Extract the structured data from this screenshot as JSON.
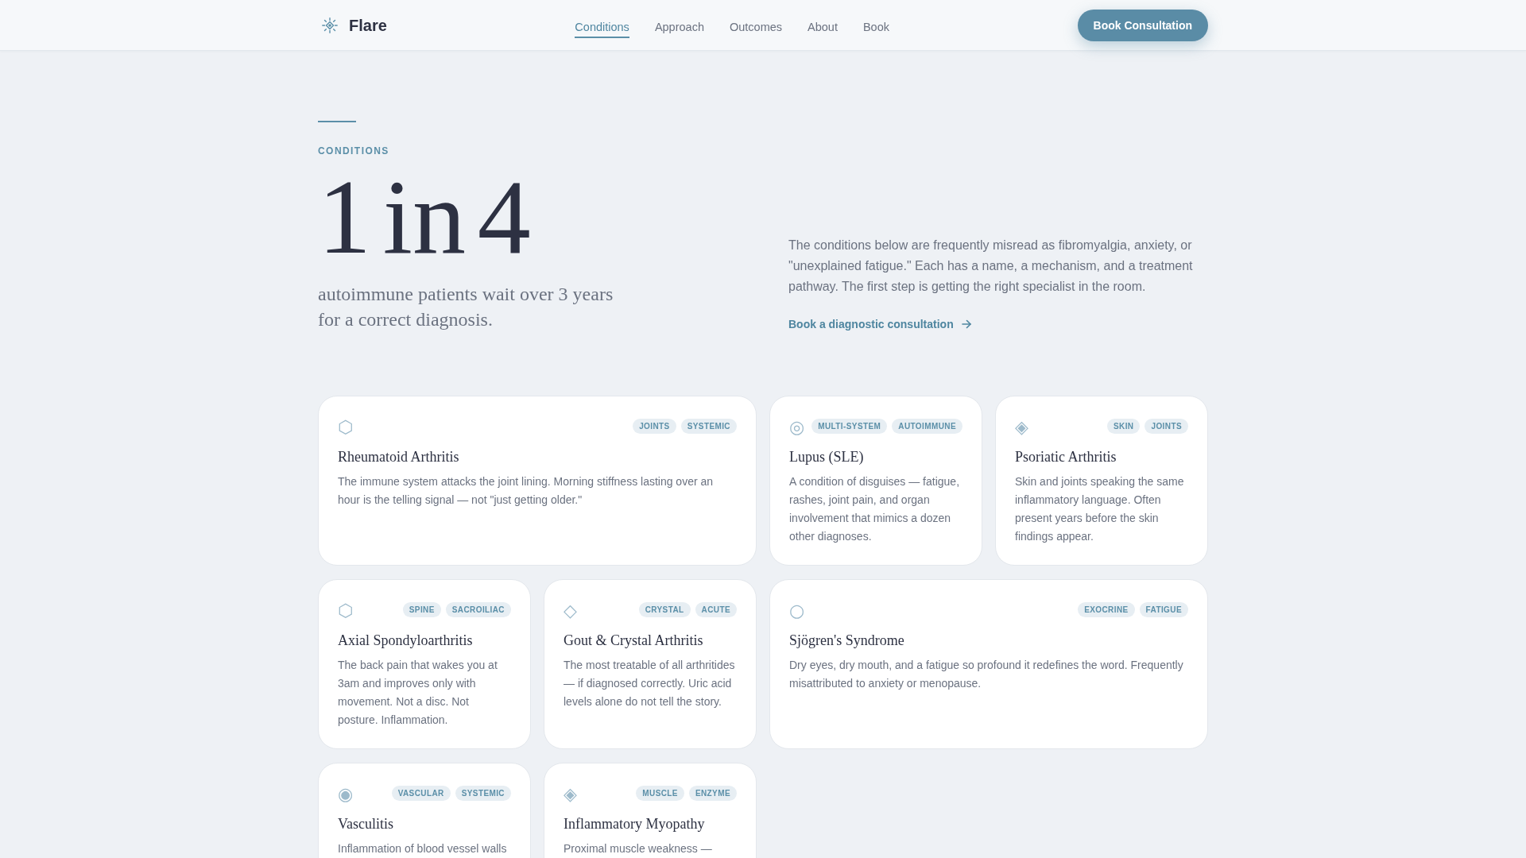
{
  "header": {
    "logo": "Flare",
    "nav": [
      {
        "label": "Conditions",
        "selected": true
      },
      {
        "label": "Approach",
        "selected": false
      },
      {
        "label": "Outcomes",
        "selected": false
      },
      {
        "label": "About",
        "selected": false
      },
      {
        "label": "Book",
        "selected": false
      }
    ],
    "cta": "Book Consultation"
  },
  "hero": {
    "eyebrow": "CONDITIONS",
    "headline": "1 in 4",
    "subheadline": "autoimmune patients wait over 3 years for a correct diagnosis.",
    "description": "The conditions below are frequently misread as fibromyalgia, anxiety, or \"unexplained fatigue.\" Each has a name, a mechanism, and a treatment pathway. The first step is getting the right specialist in the room.",
    "link": "Book a diagnostic consultation"
  },
  "conditions": [
    {
      "icon": "⬡",
      "tags": [
        "JOINTS",
        "SYSTEMIC"
      ],
      "title": "Rheumatoid Arthritis",
      "description": "The immune system attacks the joint lining. Morning stiffness lasting over an hour is the telling signal — not \"just getting older.\""
    },
    {
      "icon": "◎",
      "tags": [
        "MULTI-SYSTEM",
        "AUTOIMMUNE"
      ],
      "title": "Lupus (SLE)",
      "description": "A condition of disguises — fatigue, rashes, joint pain, and organ involvement that mimics a dozen other diagnoses."
    },
    {
      "icon": "◈",
      "tags": [
        "SKIN",
        "JOINTS"
      ],
      "title": "Psoriatic Arthritis",
      "description": "Skin and joints speaking the same inflammatory language. Often present years before the skin findings appear."
    },
    {
      "icon": "⬡",
      "tags": [
        "SPINE",
        "SACROILIAC"
      ],
      "title": "Axial Spondyloarthritis",
      "description": "The back pain that wakes you at 3am and improves only with movement. Not a disc. Not posture. Inflammation."
    },
    {
      "icon": "◇",
      "tags": [
        "CRYSTAL",
        "ACUTE"
      ],
      "title": "Gout & Crystal Arthritis",
      "description": "The most treatable of all arthritides — if diagnosed correctly. Uric acid levels alone do not tell the story."
    },
    {
      "icon": "○",
      "tags": [
        "EXOCRINE",
        "FATIGUE"
      ],
      "title": "Sjögren's Syndrome",
      "description": "Dry eyes, dry mouth, and a fatigue so profound it redefines the word. Frequently misattributed to anxiety or menopause."
    },
    {
      "icon": "◉",
      "tags": [
        "VASCULAR",
        "SYSTEMIC"
      ],
      "title": "Vasculitis",
      "description": "Inflammation of blood vessel walls"
    },
    {
      "icon": "◈",
      "tags": [
        "MUSCLE",
        "ENZYME"
      ],
      "title": "Inflammatory Myopathy",
      "description": "Proximal muscle weakness —"
    }
  ]
}
